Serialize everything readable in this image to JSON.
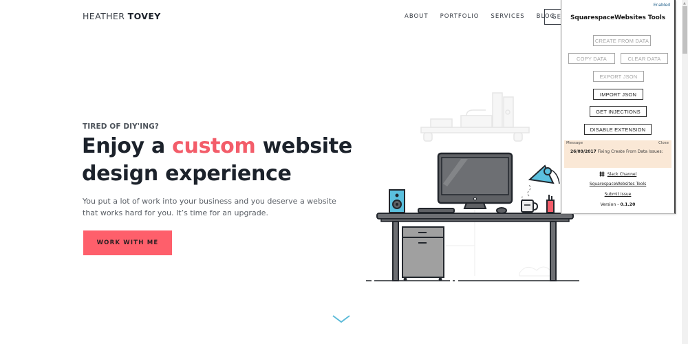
{
  "site": {
    "logo": {
      "first": "HEATHER",
      "last": "TOVEY"
    },
    "nav": {
      "items": [
        {
          "label": "ABOUT"
        },
        {
          "label": "PORTFOLIO"
        },
        {
          "label": "SERVICES"
        },
        {
          "label": "BLOG"
        }
      ],
      "cta_label_partial": "GET"
    },
    "hero": {
      "eyebrow": "TIRED OF DIY'ING?",
      "headline_before": "Enjoy a ",
      "headline_accent": "custom",
      "headline_after": " website design experience",
      "lede": "You put a lot of work into your business and you deserve a website that works hard for you. It’s time for an upgrade.",
      "cta_label": "WORK WITH ME"
    },
    "colors": {
      "accent": "#f35d6a",
      "cta_bg": "#fe5f6b",
      "text_dark": "#1c222b",
      "illustration_blue": "#5bc0de",
      "scroll_arrow": "#5bbad8"
    },
    "scroll_icon": "chevron-down-icon"
  },
  "extension": {
    "status": "Enabled",
    "title": "SquarespaceWebsites Tools",
    "buttons": {
      "create_from_data": {
        "label": "CREATE FROM DATA",
        "state": "disabled"
      },
      "copy_data": {
        "label": "COPY DATA",
        "state": "disabled"
      },
      "clear_data": {
        "label": "CLEAR DATA",
        "state": "disabled"
      },
      "export_json": {
        "label": "EXPORT JSON",
        "state": "disabled"
      },
      "import_json": {
        "label": "IMPORT JSON",
        "state": "enabled"
      },
      "get_injections": {
        "label": "GET INJECTIONS",
        "state": "enabled"
      },
      "disable_extension": {
        "label": "DISABLE EXTENSION",
        "state": "enabled"
      }
    },
    "message": {
      "label": "Message",
      "close_label": "Close",
      "date": "26/09/2017",
      "text": "Fixing Create From Data Issues:",
      "bg_color": "#fae8d6"
    },
    "links": {
      "slack": "Slack Channel",
      "tools": "SquarespaceWebsites Tools",
      "submit_issue": "Submit Issue"
    },
    "version_label": "Version - ",
    "version": "0.1.20"
  }
}
